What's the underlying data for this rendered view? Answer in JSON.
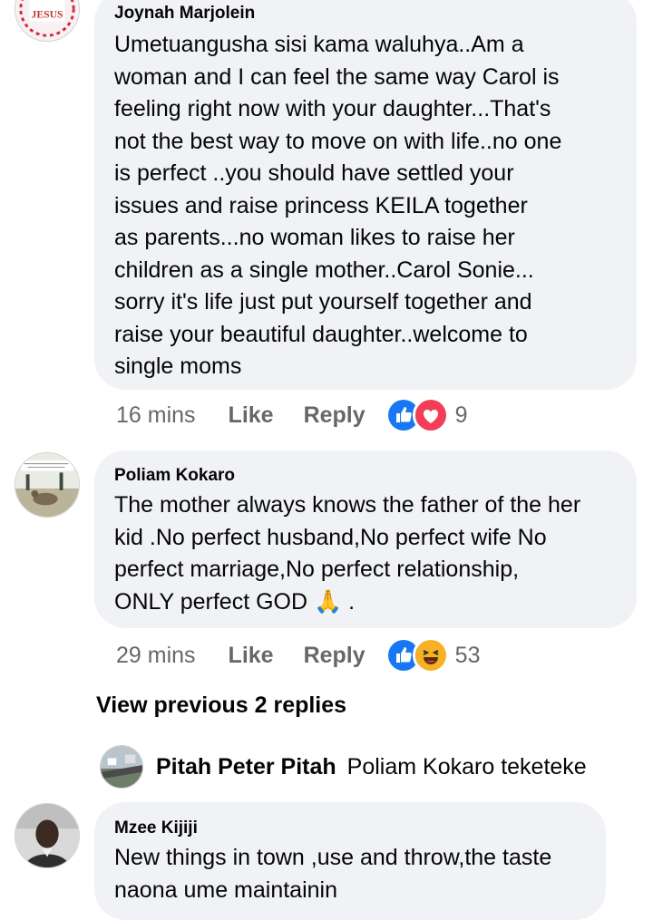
{
  "comments": [
    {
      "author": "Joynah Marjolein",
      "avatar_text": "JESUS",
      "text": "Umetuangusha sisi kama waluhya..Am a\nwoman and  I  can feel the same  way Carol  is\nfeeling right now  with your daughter...That's\nnot the best way  to  move  on with life..no one\n is  perfect  ..you should have  settled  your\nissues  and raise    princess  KEILA  together\nas parents...no woman likes to  raise her\nchildren as a  single mother..Carol  Sonie...\nsorry it's life just put yourself together  and\nraise your beautiful daughter..welcome to\nsingle moms",
      "time": "16 mins",
      "like_label": "Like",
      "reply_label": "Reply",
      "reactions": [
        "like-icon",
        "love-icon"
      ],
      "reaction_count": "9"
    },
    {
      "author": "Poliam Kokaro",
      "text": "The mother always knows the father of the her\nkid .No perfect husband,No perfect wife No\nperfect marriage,No perfect relationship,\nONLY perfect GOD",
      "text_emoji": "🙏",
      "text_suffix": " .",
      "time": "29 mins",
      "like_label": "Like",
      "reply_label": "Reply",
      "reactions": [
        "like-icon",
        "haha-icon"
      ],
      "reaction_count": "53"
    },
    {
      "author": "Mzee Kijiji",
      "text": "New things in town ,use and throw,the taste\nnaona ume maintainin"
    }
  ],
  "view_previous": "View previous 2 replies",
  "reply_preview": {
    "author": "Pitah Peter Pitah",
    "text": "Poliam Kokaro teketeke"
  },
  "colors": {
    "bubble": "#f0f2f5",
    "meta": "#65676b",
    "like_blue": "#1877f2",
    "love_red": "#f33e58",
    "haha_yellow": "#f7b125"
  }
}
